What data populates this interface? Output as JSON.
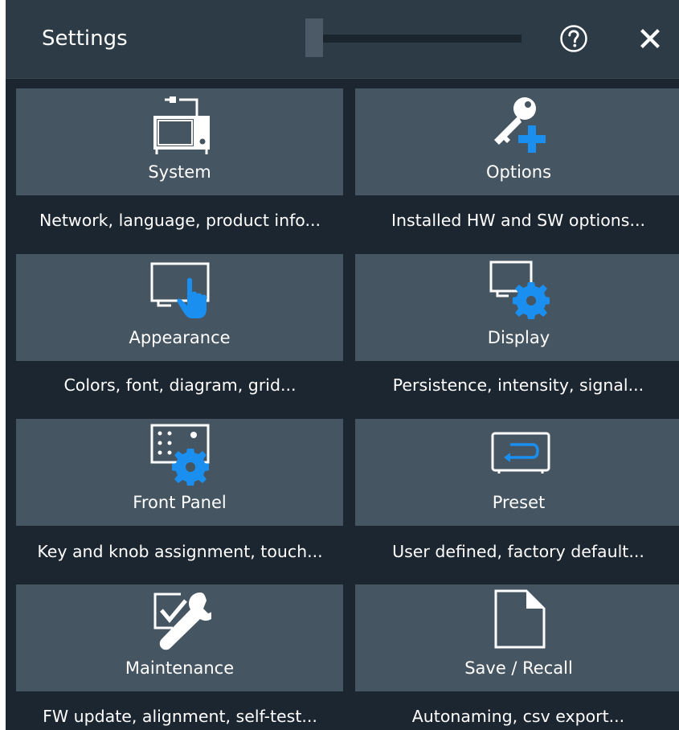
{
  "header": {
    "title": "Settings",
    "help_icon": "help-circle-icon",
    "close_icon": "close-icon"
  },
  "colors": {
    "background": "#1c2630",
    "header": "#2d3b46",
    "tile": "#455561",
    "accent_blue": "#1a8ff0",
    "icon_white": "#ffffff"
  },
  "tiles": [
    {
      "label": "System",
      "description": "Network, language, product info...",
      "icon": "system-device-icon"
    },
    {
      "label": "Options",
      "description": "Installed HW and SW options...",
      "icon": "key-plus-icon"
    },
    {
      "label": "Appearance",
      "description": "Colors, font, diagram, grid...",
      "icon": "monitor-touch-icon"
    },
    {
      "label": "Display",
      "description": "Persistence, intensity, signal...",
      "icon": "monitor-gear-icon"
    },
    {
      "label": "Front Panel",
      "description": "Key and knob assignment, touch...",
      "icon": "panel-gear-icon"
    },
    {
      "label": "Preset",
      "description": "User defined, factory default...",
      "icon": "monitor-return-icon"
    },
    {
      "label": "Maintenance",
      "description": "FW update, alignment, self-test...",
      "icon": "checkbox-wrench-icon"
    },
    {
      "label": "Save / Recall",
      "description": "Autonaming, csv export...",
      "icon": "document-icon"
    }
  ]
}
